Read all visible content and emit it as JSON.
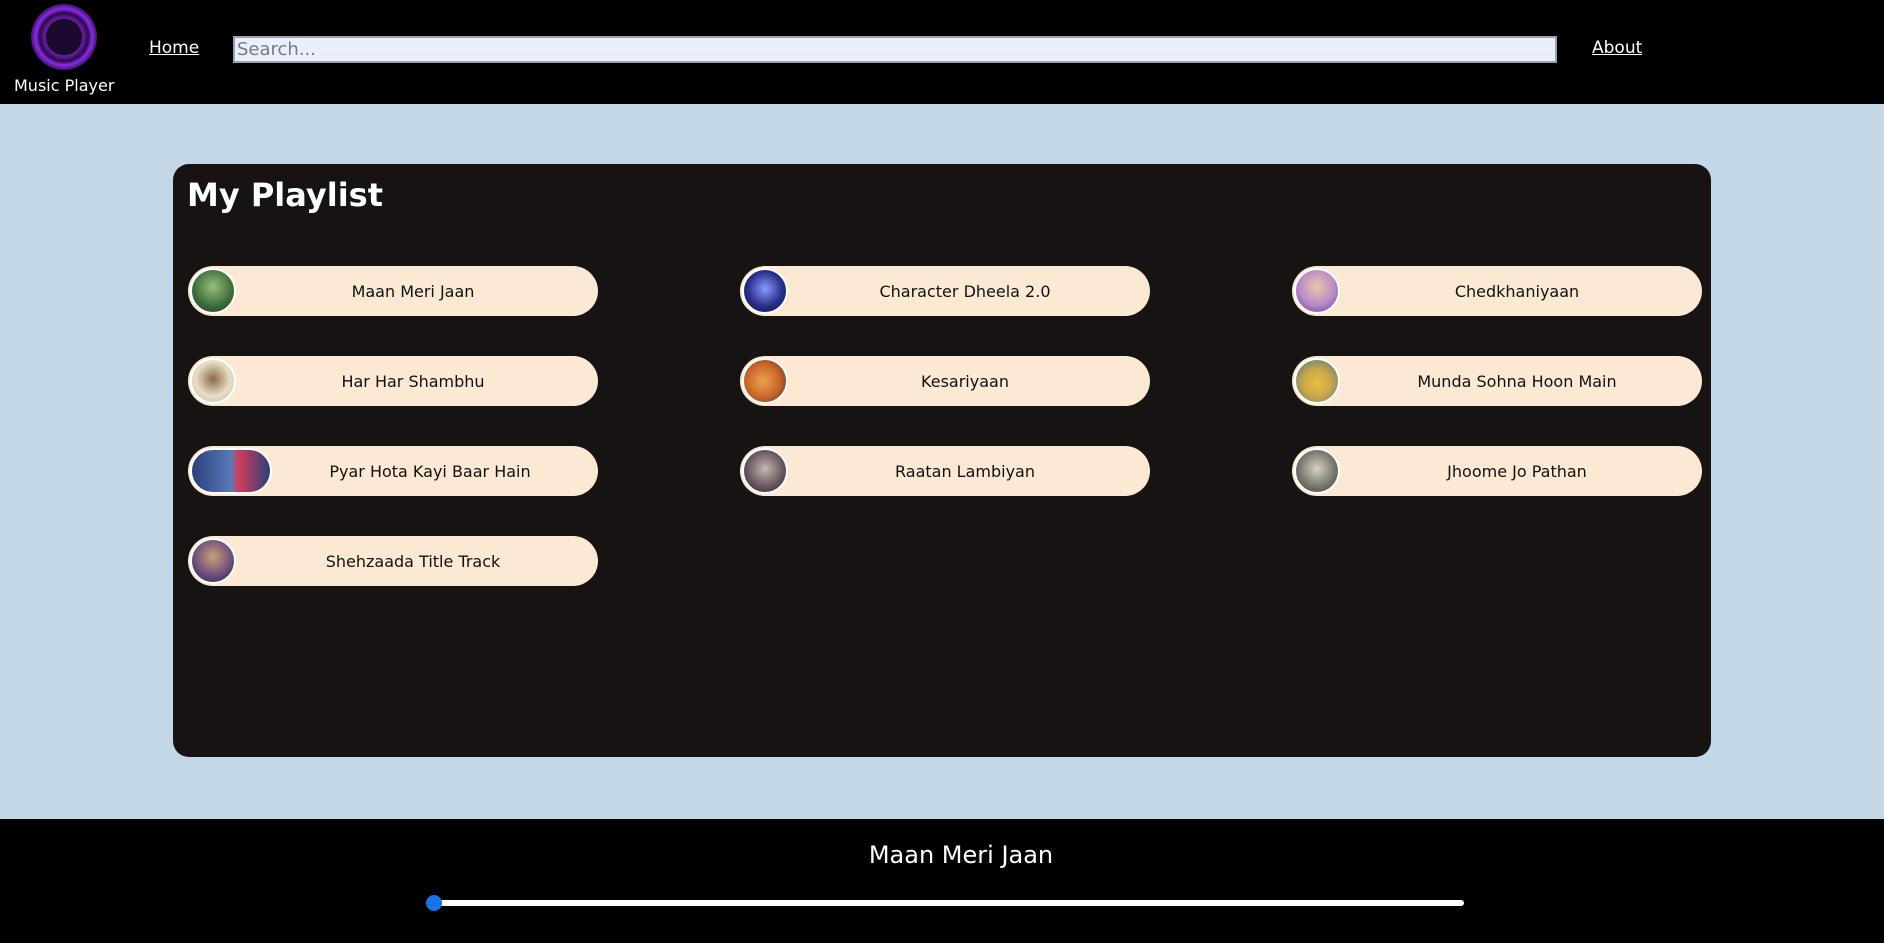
{
  "nav": {
    "brand_name": "Music Player",
    "home_label": "Home",
    "search_placeholder": "Search...",
    "about_label": "About"
  },
  "playlist": {
    "title": "My Playlist",
    "songs": [
      {
        "name": "Maan Meri Jaan",
        "thumb_color": "#3a6b3a"
      },
      {
        "name": "Character Dheela 2.0",
        "thumb_color": "#2a2f8a"
      },
      {
        "name": "Chedkhaniyaan",
        "thumb_color": "#b88ac8"
      },
      {
        "name": "Har Har Shambhu",
        "thumb_color": "#c9b79a"
      },
      {
        "name": "Kesariyaan",
        "thumb_color": "#c8642a"
      },
      {
        "name": "Munda Sohna Hoon Main",
        "thumb_color": "#c9a64a"
      },
      {
        "name": "Pyar Hota Kayi Baar Hain",
        "thumb_color": "#3a5c9a"
      },
      {
        "name": "Raatan Lambiyan",
        "thumb_color": "#6b5a62"
      },
      {
        "name": "Jhoome Jo Pathan",
        "thumb_color": "#7a7a70"
      },
      {
        "name": "Shehzaada Title Track",
        "thumb_color": "#6a4a7a"
      }
    ]
  },
  "player": {
    "now_playing": "Maan Meri Jaan",
    "progress": 0.0
  },
  "colors": {
    "page_bg": "#c4d7e6",
    "card_bg": "#161312",
    "song_pill": "#fbe9d4",
    "wave_orange": "#ff5a1a",
    "wave_yellow": "#ffc040",
    "slider_knob": "#1a73e8"
  }
}
